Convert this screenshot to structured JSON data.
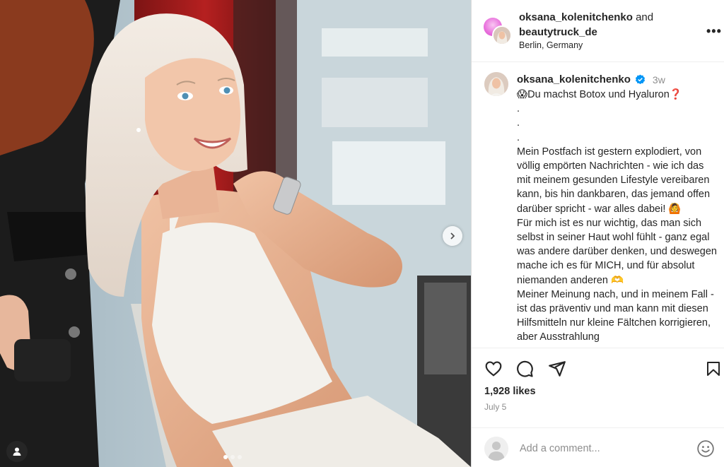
{
  "post": {
    "header": {
      "user1": "oksana_kolenitchenko",
      "and_text": "and",
      "user2": "beautytruck_de",
      "location": "Berlin, Germany",
      "more_label": "•••"
    },
    "caption": {
      "username": "oksana_kolenitchenko",
      "time": "3w",
      "text": "😱Du machst Botox und Hyaluron❓\n.\n.\n.\nMein Postfach ist gestern explodiert, von völlig empörten Nachrichten - wie ich das mit meinem gesunden Lifestyle vereibaren kann, bis hin dankbaren, das jemand offen darüber spricht - war alles dabei! 🙆\nFür mich ist es nur wichtig, das man sich selbst in seiner Haut wohl fühlt - ganz egal was andere darüber denken, und deswegen mache ich es für MICH, und für absolut niemanden anderen 🫶\nMeiner Meinung nach, und in meinem Fall - ist das präventiv und man kann mit diesen Hilfsmitteln nur kleine Fältchen korrigieren, aber Ausstrahlung"
    },
    "likes": "1,928 likes",
    "date": "July 5",
    "comment_placeholder": "Add a comment...",
    "carousel": {
      "count": 3,
      "active": 0
    }
  },
  "icons": {
    "like": "heart-icon",
    "comment": "comment-icon",
    "share": "send-icon",
    "save": "bookmark-icon",
    "emoji": "emoji-icon",
    "next": "chevron-right-icon",
    "tags": "user-tag-icon",
    "verified": "verified-badge-icon"
  },
  "colors": {
    "verified": "#0095f6",
    "muted": "#8e8e8e",
    "text": "#262626"
  }
}
